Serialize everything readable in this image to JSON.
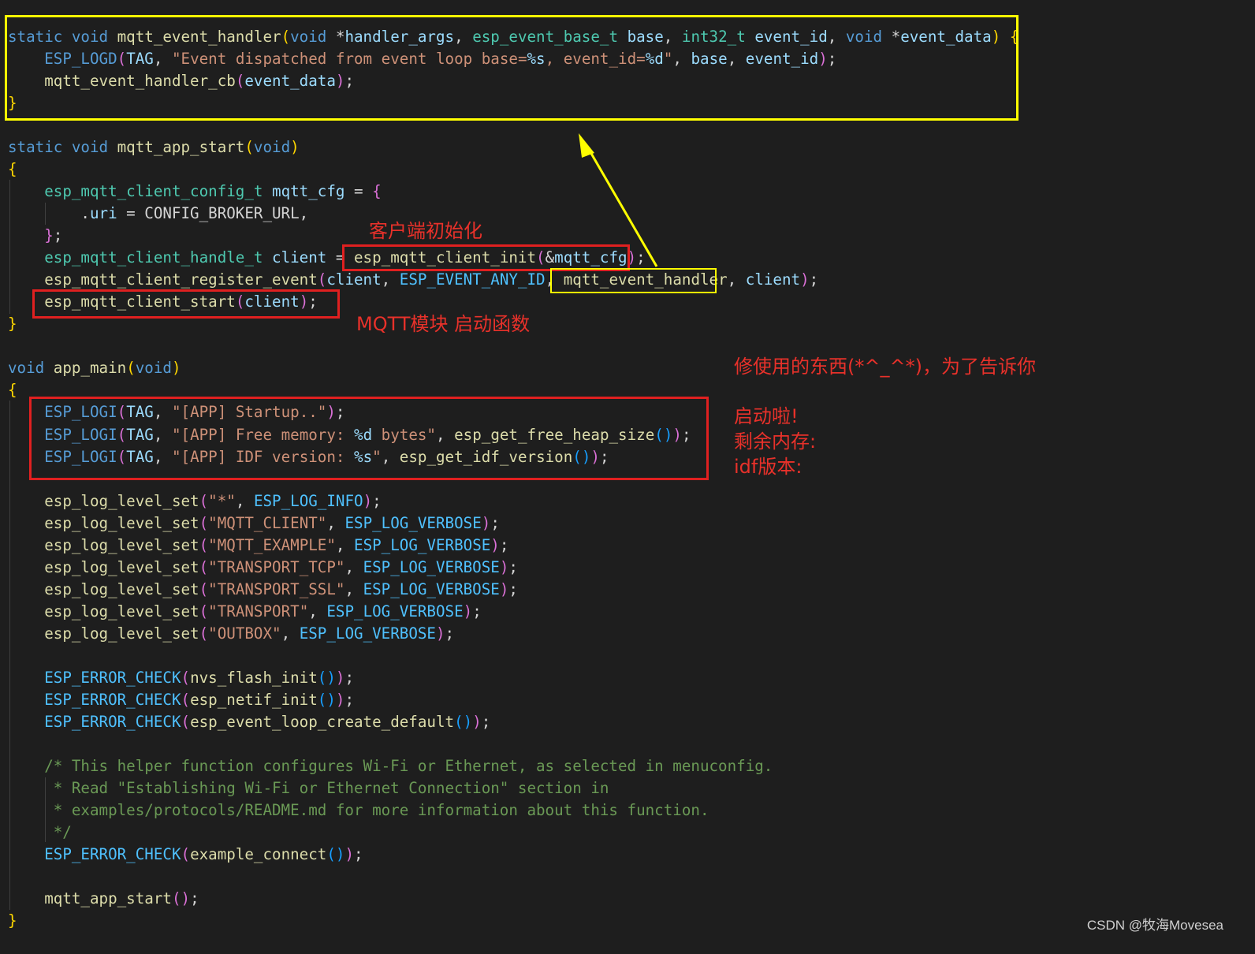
{
  "colors": {
    "background": "#1e1e1e",
    "annotation_text": "#e8312a",
    "highlight_yellow": "#ffff00",
    "highlight_red": "#e02020"
  },
  "code": {
    "handler_sig_1": "static void mqtt_event_handler(void *handler_args, esp_event_base_t base, int32_t event_id, void *event_data) {",
    "handler_logd": "    ESP_LOGD(TAG, \"Event dispatched from event loop base=%s, event_id=%d\", base, event_id);",
    "handler_cb": "    mqtt_event_handler_cb(event_data);",
    "close_brace": "}",
    "app_start_sig": "static void mqtt_app_start(void)",
    "open_brace": "{",
    "cfg_decl": "    esp_mqtt_client_config_t mqtt_cfg = {",
    "cfg_uri": "        .uri = CONFIG_BROKER_URL,",
    "cfg_end": "    };",
    "client_init": "    esp_mqtt_client_handle_t client = esp_mqtt_client_init(&mqtt_cfg);",
    "register_event": "    esp_mqtt_client_register_event(client, ESP_EVENT_ANY_ID, mqtt_event_handler, client);",
    "client_start": "    esp_mqtt_client_start(client);",
    "app_main_sig": "void app_main(void)",
    "logi_startup": "    ESP_LOGI(TAG, \"[APP] Startup..\");",
    "logi_memory": "    ESP_LOGI(TAG, \"[APP] Free memory: %d bytes\", esp_get_free_heap_size());",
    "logi_idf": "    ESP_LOGI(TAG, \"[APP] IDF version: %s\", esp_get_idf_version());",
    "lvl_all": "    esp_log_level_set(\"*\", ESP_LOG_INFO);",
    "lvl_mqtt_client": "    esp_log_level_set(\"MQTT_CLIENT\", ESP_LOG_VERBOSE);",
    "lvl_mqtt_example": "    esp_log_level_set(\"MQTT_EXAMPLE\", ESP_LOG_VERBOSE);",
    "lvl_tcp": "    esp_log_level_set(\"TRANSPORT_TCP\", ESP_LOG_VERBOSE);",
    "lvl_ssl": "    esp_log_level_set(\"TRANSPORT_SSL\", ESP_LOG_VERBOSE);",
    "lvl_transport": "    esp_log_level_set(\"TRANSPORT\", ESP_LOG_VERBOSE);",
    "lvl_outbox": "    esp_log_level_set(\"OUTBOX\", ESP_LOG_VERBOSE);",
    "err_nvs": "    ESP_ERROR_CHECK(nvs_flash_init());",
    "err_netif": "    ESP_ERROR_CHECK(esp_netif_init());",
    "err_loop": "    ESP_ERROR_CHECK(esp_event_loop_create_default());",
    "cm_1": "    /* This helper function configures Wi-Fi or Ethernet, as selected in menuconfig.",
    "cm_2": "     * Read \"Establishing Wi-Fi or Ethernet Connection\" section in",
    "cm_3": "     * examples/protocols/README.md for more information about this function.",
    "cm_4": "     */",
    "err_connect": "    ESP_ERROR_CHECK(example_connect());",
    "call_app_start": "    mqtt_app_start();"
  },
  "annotations": {
    "client_init": "客户端初始化",
    "start_fn": "MQTT模块 启动函数",
    "log_note_1": "修使用的东西(*^_^*)，为了告诉你",
    "log_note_2": "启动啦!",
    "log_note_3": "剩余内存:",
    "log_note_4": "idf版本:"
  },
  "watermark": "CSDN @牧海Movesea"
}
